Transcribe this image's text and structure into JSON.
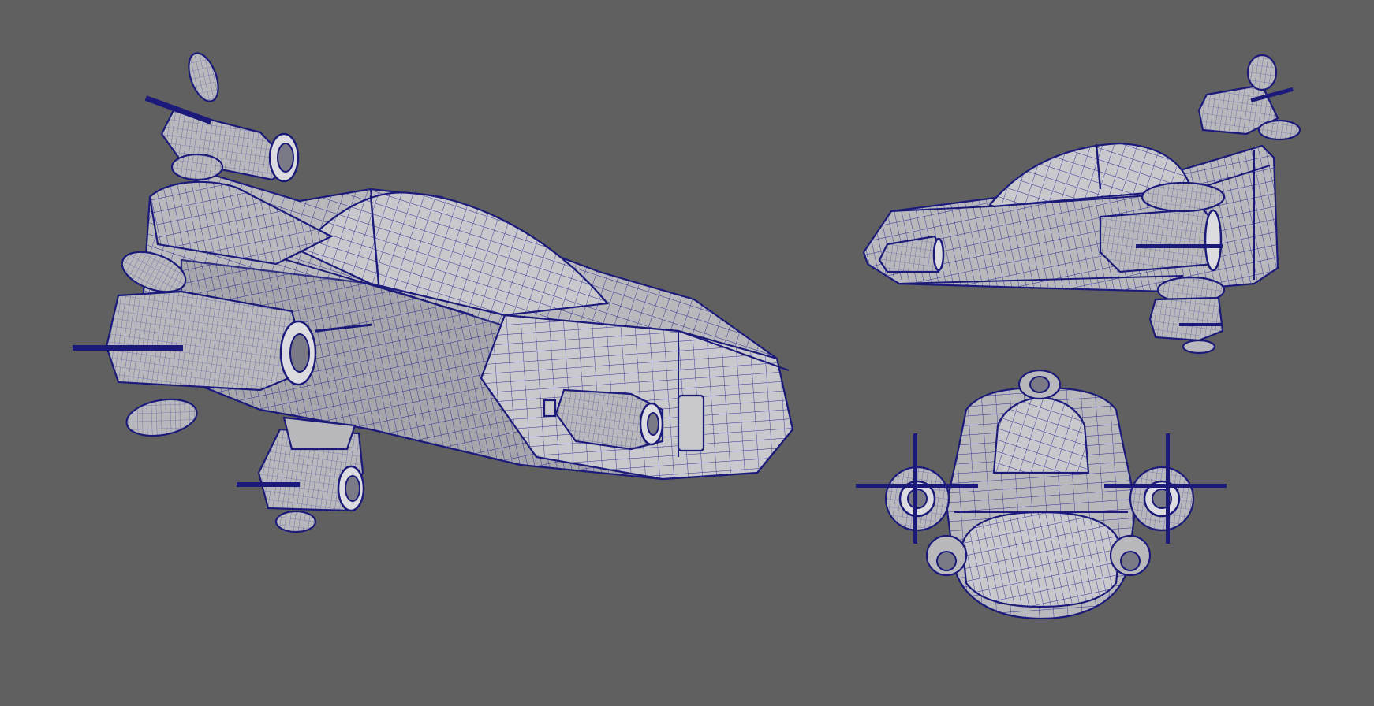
{
  "viewport": {
    "background_color": "#606060",
    "wireframe_color": "#1b1a7a",
    "surface_color": "#b9b9bd"
  },
  "views": [
    {
      "name": "perspective-view",
      "subject": "spaceship-wireframe-model"
    },
    {
      "name": "side-view",
      "subject": "spaceship-wireframe-model"
    },
    {
      "name": "front-view",
      "subject": "spaceship-wireframe-model"
    }
  ]
}
